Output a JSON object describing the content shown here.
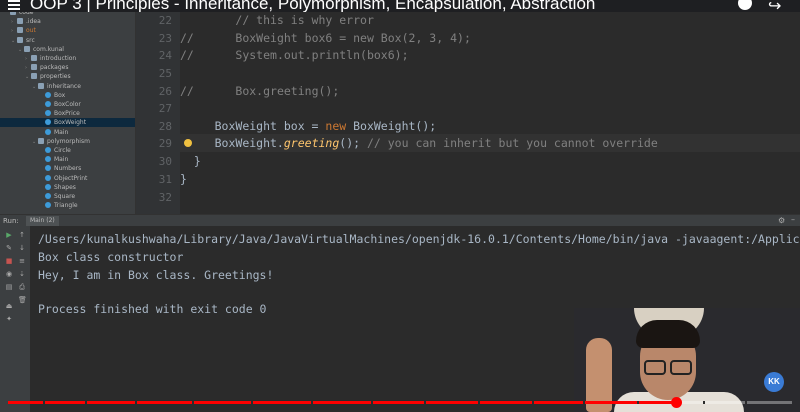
{
  "video": {
    "title": "OOP 3 | Principles - Inheritance, Polymorphism, Encapsulation, Abstraction",
    "progress_percent": 85.2,
    "progress_color": "#ff0000",
    "channel_logo_text": "KK"
  },
  "project_tree": {
    "items": [
      {
        "label": "code",
        "type": "folder",
        "arrow": "",
        "indent": 0
      },
      {
        "label": ".idea",
        "type": "folder",
        "arrow": "›",
        "indent": 1
      },
      {
        "label": "out",
        "type": "folder",
        "arrow": "›",
        "indent": 1,
        "highlight": true
      },
      {
        "label": "src",
        "type": "folder",
        "arrow": "⌄",
        "indent": 1
      },
      {
        "label": "com.kunal",
        "type": "folder",
        "arrow": "⌄",
        "indent": 2
      },
      {
        "label": "introduction",
        "type": "folder",
        "arrow": "›",
        "indent": 3
      },
      {
        "label": "packages",
        "type": "folder",
        "arrow": "›",
        "indent": 3
      },
      {
        "label": "properties",
        "type": "folder",
        "arrow": "⌄",
        "indent": 3
      },
      {
        "label": "inheritance",
        "type": "folder",
        "arrow": "⌄",
        "indent": 4
      },
      {
        "label": "Box",
        "type": "class",
        "arrow": "",
        "indent": 5
      },
      {
        "label": "BoxColor",
        "type": "class",
        "arrow": "",
        "indent": 5
      },
      {
        "label": "BoxPrice",
        "type": "class",
        "arrow": "",
        "indent": 5
      },
      {
        "label": "BoxWeight",
        "type": "class",
        "arrow": "",
        "indent": 5,
        "selected": true
      },
      {
        "label": "Main",
        "type": "class",
        "arrow": "",
        "indent": 5
      },
      {
        "label": "polymorphism",
        "type": "folder",
        "arrow": "⌄",
        "indent": 4
      },
      {
        "label": "Circle",
        "type": "class",
        "arrow": "",
        "indent": 5
      },
      {
        "label": "Main",
        "type": "class",
        "arrow": "",
        "indent": 5
      },
      {
        "label": "Numbers",
        "type": "class",
        "arrow": "",
        "indent": 5
      },
      {
        "label": "ObjectPrint",
        "type": "class",
        "arrow": "",
        "indent": 5
      },
      {
        "label": "Shapes",
        "type": "class",
        "arrow": "",
        "indent": 5
      },
      {
        "label": "Square",
        "type": "class",
        "arrow": "",
        "indent": 5
      },
      {
        "label": "Triangle",
        "type": "class",
        "arrow": "",
        "indent": 5
      }
    ]
  },
  "editor": {
    "line_numbers": [
      "22",
      "23",
      "24",
      "25",
      "26",
      "27",
      "28",
      "29",
      "30",
      "31",
      "32"
    ],
    "code": {
      "l22": "// this is why error",
      "l23_prefix": "//",
      "l23_type": "BoxWeight box6 = new Box(",
      "l23_n1": "2",
      "l23_sep1": ", ",
      "l23_n2": "3",
      "l23_sep2": ", ",
      "l23_n3": "4",
      "l23_end": ");",
      "l24_prefix": "//",
      "l24_text": "System.out.println(box6);",
      "l26_prefix": "//",
      "l26_text": "Box.greeting();",
      "l28_type": "BoxWeight box = ",
      "l28_kw": "new",
      "l28_end": " BoxWeight();",
      "l29_obj": "BoxWeight.",
      "l29_method": "greeting",
      "l29_end": "();",
      "l29_comment": "// you can inherit but you cannot override",
      "l30": "}",
      "l31": "}"
    }
  },
  "run_panel": {
    "label": "Run:",
    "tab": "Main (2)",
    "console_lines": [
      "/Users/kunalkushwaha/Library/Java/JavaVirtualMachines/openjdk-16.0.1/Contents/Home/bin/java -javaagent:/Applic",
      "Box class constructor",
      "Hey, I am in Box class. Greetings!",
      "",
      "Process finished with exit code 0"
    ]
  }
}
